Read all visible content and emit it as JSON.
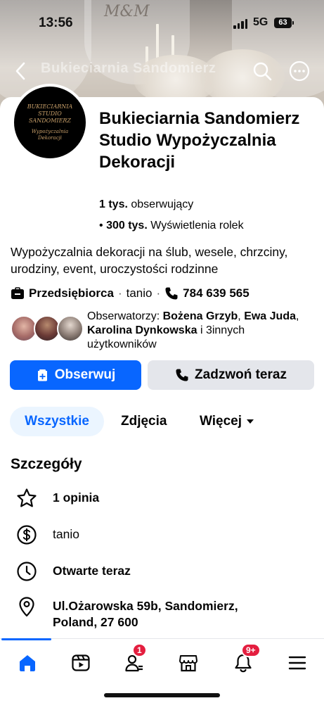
{
  "status_bar": {
    "time": "13:56",
    "network": "5G",
    "battery": "63"
  },
  "cover": {
    "monogram": "M&M",
    "blurred_title": "Bukieciarnia Sandomierz"
  },
  "avatar": {
    "line1": "BUKIECIARNIA STUDIO SANDOMIERZ",
    "line2": "Wypożyczalnia Dekoracji"
  },
  "page": {
    "name": "Bukieciarnia Sandomierz Studio Wypożyczalnia Dekoracji",
    "followers_count": "1 tys.",
    "followers_label": "obserwujący",
    "reel_views_prefix": "•",
    "reel_views_count": "300 tys.",
    "reel_views_label": "Wyświetlenia rolek",
    "bio": "Wypożyczalnia dekoracji na ślub, wesele, chrzciny, urodziny, event, uroczystości rodzinne"
  },
  "meta": {
    "category": "Przedsiębiorca",
    "sep": "·",
    "price": "tanio",
    "phone": "784 639 565"
  },
  "followers_row": {
    "prefix": "Obserwatorzy:",
    "names": [
      "Bożena Grzyb",
      "Ewa Juda",
      "Karolina Dynkowska"
    ],
    "sep1": ",",
    "sep2": ",",
    "suffix": "i 3innych użytkowników"
  },
  "buttons": {
    "follow": "Obserwuj",
    "call": "Zadzwoń teraz"
  },
  "tabs": {
    "all": "Wszystkie",
    "photos": "Zdjęcia",
    "more": "Więcej"
  },
  "details": {
    "title": "Szczegóły",
    "reviews": "1 opinia",
    "price": "tanio",
    "hours": "Otwarte teraz",
    "address": "Ul.Ożarowska 59b, Sandomierz, Poland, 27 600"
  },
  "bottom_nav": {
    "items": [
      "home-icon",
      "reels-icon",
      "friends-icon",
      "marketplace-icon",
      "notifications-icon",
      "menu-icon"
    ],
    "friends_badge": "1",
    "notifications_badge": "9+"
  },
  "colors": {
    "accent": "#0866ff",
    "badge": "#e41e3f",
    "secondary_button": "#e4e6eb"
  }
}
